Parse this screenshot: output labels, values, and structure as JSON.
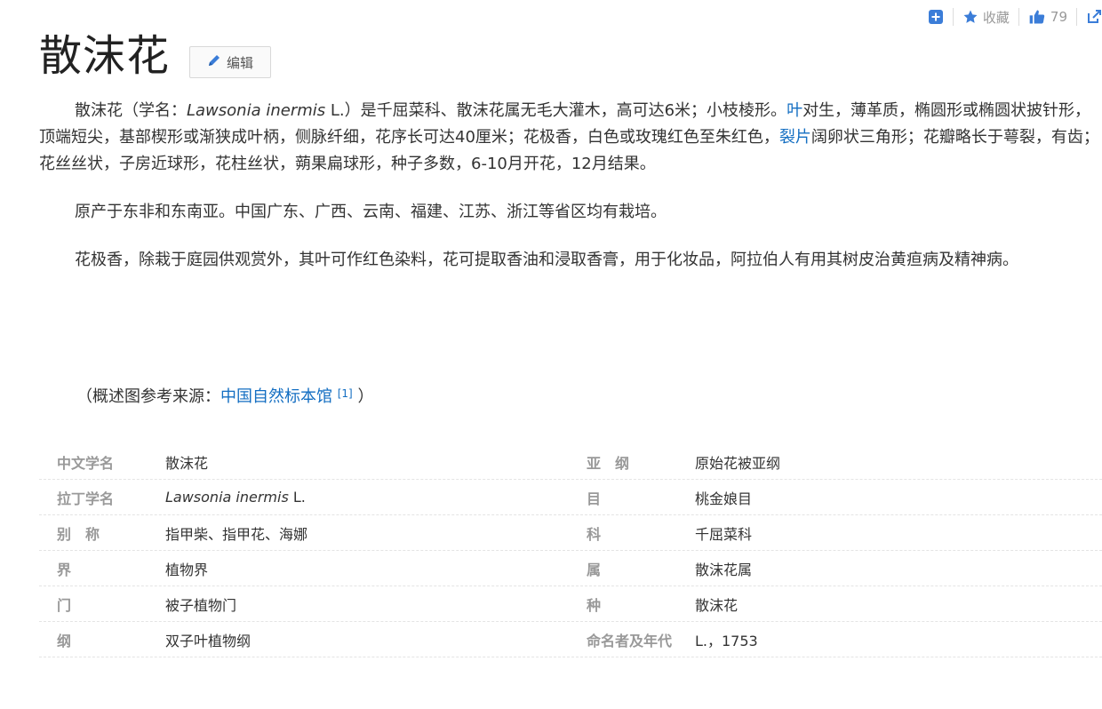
{
  "toolbar": {
    "collect_label": "收藏",
    "like_count": "79",
    "colors": {
      "icon_blue": "#3b7dd8",
      "text_gray": "#999999"
    }
  },
  "title": "散沫花",
  "edit_label": "编辑",
  "paragraphs": {
    "p1": {
      "a": "散沫花（学名：",
      "latin": "Lawsonia inermis",
      "b": " L.）是千屈菜科、散沫花属无毛大灌木，高可达6米；小枝棱形。",
      "link1": "叶",
      "c": "对生，薄革质，椭圆形或椭圆状披针形，顶端短尖，基部楔形或渐狭成叶柄，侧脉纤细，花序长可达40厘米；花极香，白色或玫瑰红色至朱红色，",
      "link2": "裂片",
      "d": "阔卵状三角形；花瓣略长于萼裂，有齿；花丝丝状，子房近球形，花柱丝状，蒴果扁球形，种子多数，6-10月开花，12月结果。"
    },
    "p2": "原产于东非和东南亚。中国广东、广西、云南、福建、江苏、浙江等省区均有栽培。",
    "p3": "花极香，除栽于庭园供观赏外，其叶可作红色染料，花可提取香油和浸取香膏，用于化妆品，阿拉伯人有用其树皮治黄疸病及精神病。"
  },
  "source": {
    "prefix": "（概述图参考来源：",
    "link": "中国自然标本馆",
    "ref": "[1]",
    "suffix": " ）"
  },
  "info_table": {
    "rows": [
      {
        "name1": "中文学名",
        "value1": "散沫花",
        "name2": "亚　纲",
        "value2": "原始花被亚纲"
      },
      {
        "name1": "拉丁学名",
        "value1_latin": "Lawsonia inermis",
        "value1_suffix": " L.",
        "name2": "目",
        "value2": "桃金娘目"
      },
      {
        "name1": "别　称",
        "value1": "指甲柴、指甲花、海娜",
        "name2": "科",
        "value2": "千屈菜科"
      },
      {
        "name1": "界",
        "value1": "植物界",
        "name2": "属",
        "value2": "散沫花属"
      },
      {
        "name1": "门",
        "value1": "被子植物门",
        "name2": "种",
        "value2": "散沫花"
      },
      {
        "name1": "纲",
        "value1": "双子叶植物纲",
        "name2": "命名者及年代",
        "value2": "L.，1753"
      }
    ]
  },
  "link_color": "#136ec2"
}
